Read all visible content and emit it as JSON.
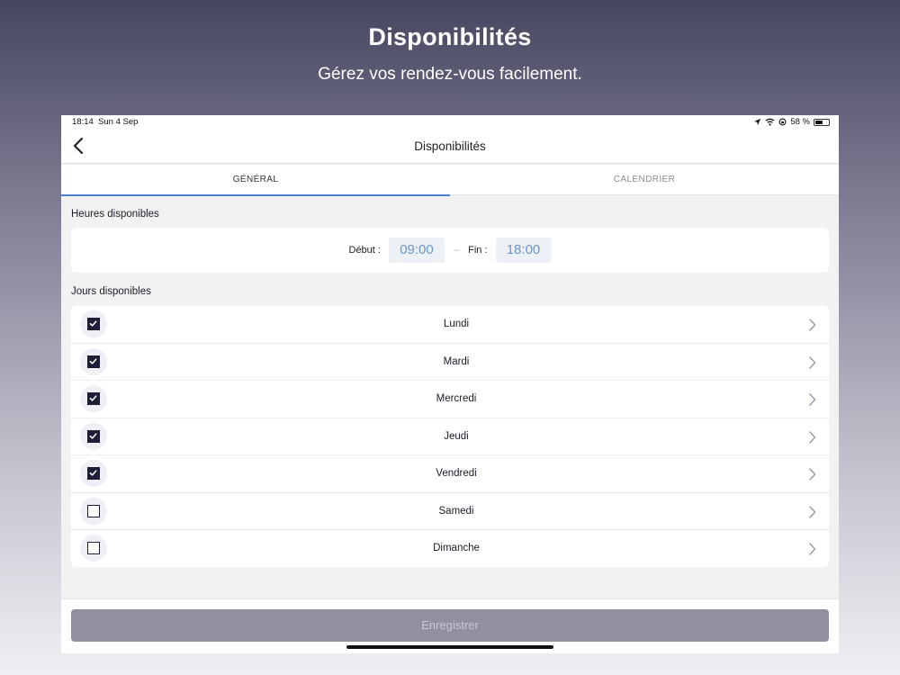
{
  "promo": {
    "title": "Disponibilités",
    "subtitle": "Gérez vos rendez-vous facilement."
  },
  "status_bar": {
    "time": "18:14",
    "date": "Sun 4 Sep",
    "battery": "58 %",
    "battery_level": 0.58
  },
  "nav": {
    "title": "Disponibilités",
    "back_icon": "chevron-left-icon"
  },
  "tabs": [
    {
      "label": "GÉNÉRAL",
      "active": true
    },
    {
      "label": "CALENDRIER",
      "active": false
    }
  ],
  "hours": {
    "section_label": "Heures disponibles",
    "start_label": "Début :",
    "start_value": "09:00",
    "separator": "–",
    "end_label": "Fin :",
    "end_value": "18:00"
  },
  "days": {
    "section_label": "Jours disponibles",
    "items": [
      {
        "label": "Lundi",
        "checked": true
      },
      {
        "label": "Mardi",
        "checked": true
      },
      {
        "label": "Mercredi",
        "checked": true
      },
      {
        "label": "Jeudi",
        "checked": true
      },
      {
        "label": "Vendredi",
        "checked": true
      },
      {
        "label": "Samedi",
        "checked": false
      },
      {
        "label": "Dimanche",
        "checked": false
      }
    ]
  },
  "footer": {
    "save_label": "Enregistrer"
  },
  "colors": {
    "accent": "#4a7fd0",
    "checkbox": "#1f1e3a",
    "time_text": "#6b97c7",
    "save_button": "#918fa0"
  }
}
